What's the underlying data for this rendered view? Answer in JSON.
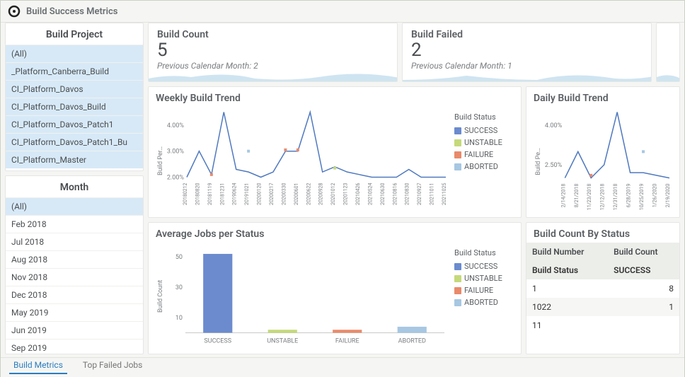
{
  "app": {
    "title": "Build Success Metrics"
  },
  "sidebar": {
    "project": {
      "title": "Build Project",
      "items": [
        {
          "label": "(All)",
          "selected": true
        },
        {
          "label": "_Platform_Canberra_Build",
          "selected": true
        },
        {
          "label": "CI_Platform_Davos",
          "selected": true
        },
        {
          "label": "CI_Platform_Davos_Build",
          "selected": true
        },
        {
          "label": "CI_Platform_Davos_Patch1",
          "selected": true
        },
        {
          "label": "CI_Platform_Davos_Patch1_Bu",
          "selected": true
        },
        {
          "label": "CI_Platform_Master",
          "selected": true
        }
      ]
    },
    "month": {
      "title": "Month",
      "items": [
        {
          "label": "(All)",
          "selected": true
        },
        {
          "label": "Feb 2018"
        },
        {
          "label": "Jul 2018"
        },
        {
          "label": "Aug 2018"
        },
        {
          "label": "Nov 2018"
        },
        {
          "label": "Dec 2018"
        },
        {
          "label": "May 2019"
        },
        {
          "label": "Jun 2019"
        },
        {
          "label": "Sep 2019"
        }
      ]
    }
  },
  "kpi": {
    "buildCount": {
      "title": "Build Count",
      "value": "5",
      "sub": "Previous Calendar Month: 2"
    },
    "buildFailed": {
      "title": "Build Failed",
      "value": "2",
      "sub": "Previous Calendar Month: 1"
    }
  },
  "weekly": {
    "title": "Weekly Build Trend",
    "ylabel": "Build Per…",
    "legend_title": "Build Status",
    "legend": [
      "SUCCESS",
      "UNSTABLE",
      "FAILURE",
      "ABORTED"
    ]
  },
  "daily": {
    "title": "Daily Build Trend",
    "ylabel": "Build Pe…"
  },
  "avg": {
    "title": "Average Jobs per Status",
    "ylabel": "Build Count",
    "legend_title": "Build Status",
    "legend": [
      "SUCCESS",
      "UNSTABLE",
      "FAILURE",
      "ABORTED"
    ]
  },
  "statusTable": {
    "title": "Build Count By Status",
    "status_label": "Build Status",
    "status_value": "SUCCESS",
    "cols": [
      "Build Number",
      "Build Count"
    ],
    "rows": [
      {
        "num": "1",
        "count": "8"
      },
      {
        "num": "1022",
        "count": "1"
      },
      {
        "num": "11",
        "count": ""
      }
    ]
  },
  "tabs": [
    {
      "label": "Build Metrics",
      "active": true
    },
    {
      "label": "Top Failed Jobs",
      "active": false
    }
  ],
  "colors": {
    "success": "#6b8bce",
    "unstable": "#c5d97a",
    "failure": "#e98a6b",
    "aborted": "#a7c7e2",
    "line": "#4f79bf",
    "area": "#cfe4f1"
  },
  "chart_data": [
    {
      "id": "weekly_build_trend",
      "type": "line",
      "title": "Weekly Build Trend",
      "ylabel": "Build Per…",
      "ylim": [
        2.0,
        4.5
      ],
      "yticks": [
        2.0,
        3.0,
        4.0
      ],
      "ytick_suffix": "%",
      "categories": [
        "20180212",
        "20180820",
        "20181119",
        "20181231",
        "20190624",
        "20191021",
        "20200120",
        "20200217",
        "20200330",
        "20200601",
        "20200622",
        "20200928",
        "20201012",
        "20201123",
        "20210426",
        "20210524",
        "20210630",
        "20210816",
        "20210830",
        "20210927",
        "20211011",
        "20211025"
      ],
      "series": [
        {
          "name": "SUCCESS",
          "mark": "line",
          "values": [
            2.0,
            3.0,
            2.1,
            4.5,
            2.3,
            2.2,
            2.0,
            2.2,
            3.0,
            3.0,
            4.5,
            2.2,
            2.4,
            2.2,
            2.1,
            2.0,
            2.0,
            2.0,
            2.3,
            2.0,
            2.0,
            2.0
          ]
        },
        {
          "name": "UNSTABLE",
          "mark": "point",
          "values": [
            null,
            null,
            null,
            null,
            null,
            null,
            null,
            null,
            null,
            null,
            null,
            null,
            2.35,
            null,
            null,
            null,
            null,
            null,
            null,
            null,
            null,
            null
          ]
        },
        {
          "name": "FAILURE",
          "mark": "point",
          "values": [
            null,
            null,
            2.1,
            null,
            null,
            null,
            null,
            null,
            3.05,
            3.05,
            null,
            null,
            null,
            null,
            null,
            null,
            null,
            null,
            null,
            null,
            null,
            null
          ]
        },
        {
          "name": "ABORTED",
          "mark": "point",
          "values": [
            null,
            null,
            null,
            null,
            null,
            3.0,
            null,
            null,
            null,
            null,
            null,
            null,
            null,
            null,
            null,
            null,
            null,
            null,
            null,
            null,
            null,
            null
          ]
        }
      ]
    },
    {
      "id": "daily_build_trend",
      "type": "line",
      "title": "Daily Build Trend",
      "ylabel": "Build Pe…",
      "ylim": [
        2.0,
        4.5
      ],
      "yticks": [
        2.5,
        4.0
      ],
      "ytick_suffix": "%",
      "categories": [
        "2/14/2018",
        "8/21/2018",
        "11/23/2018",
        "12/12/2018",
        "12/31/2018",
        "6/28/2019",
        "10/25/2019",
        "1/26/2020",
        "2/19/2020"
      ],
      "series": [
        {
          "name": "SUCCESS",
          "mark": "line",
          "values": [
            2.0,
            3.0,
            2.0,
            2.5,
            4.5,
            2.2,
            2.2,
            2.1,
            2.0
          ]
        },
        {
          "name": "FAILURE",
          "mark": "point",
          "values": [
            null,
            null,
            2.1,
            null,
            null,
            null,
            null,
            null,
            null
          ]
        },
        {
          "name": "ABORTED",
          "mark": "point",
          "values": [
            null,
            null,
            null,
            null,
            null,
            null,
            3.0,
            null,
            null
          ]
        }
      ]
    },
    {
      "id": "avg_jobs_per_status",
      "type": "bar",
      "title": "Average Jobs per Status",
      "ylabel": "Build Count",
      "ylim": [
        0,
        55
      ],
      "yticks": [
        10,
        30,
        50
      ],
      "categories": [
        "SUCCESS",
        "UNSTABLE",
        "FAILURE",
        "ABORTED"
      ],
      "series": [
        {
          "name": "Build Count",
          "values": [
            52,
            2,
            2,
            4
          ]
        }
      ],
      "colors_by_cat": [
        "#6b8bce",
        "#c5d97a",
        "#e98a6b",
        "#a7c7e2"
      ]
    },
    {
      "id": "build_count_by_status",
      "type": "table",
      "title": "Build Count By Status",
      "filter": {
        "Build Status": "SUCCESS"
      },
      "columns": [
        "Build Number",
        "Build Count"
      ],
      "rows": [
        [
          "1",
          8
        ],
        [
          "1022",
          1
        ],
        [
          "11",
          null
        ]
      ]
    }
  ]
}
